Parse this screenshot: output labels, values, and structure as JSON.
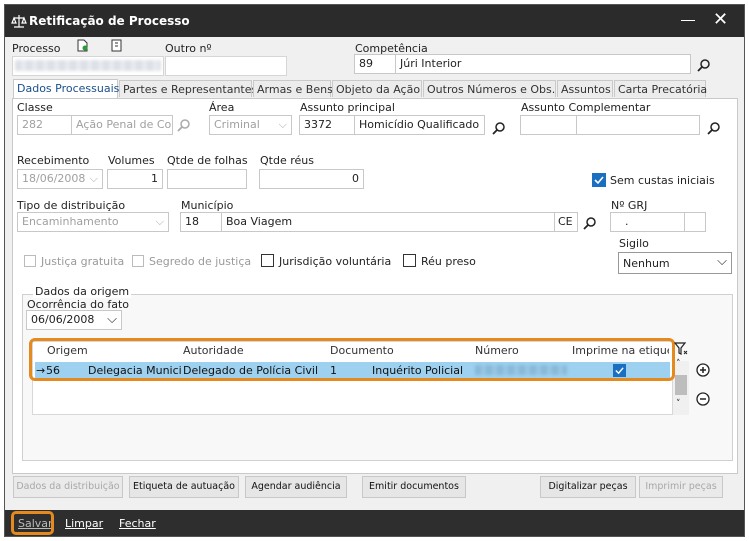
{
  "window": {
    "title": "Retificação de Processo"
  },
  "header": {
    "processo_label": "Processo",
    "outro_label": "Outro nº",
    "competencia_label": "Competência",
    "competencia_code": "89",
    "competencia_name": "Júri Interior"
  },
  "tabs": [
    {
      "label": "Dados Processuais"
    },
    {
      "label": "Partes e Representantes"
    },
    {
      "label": "Armas e Bens"
    },
    {
      "label": "Objeto da Ação"
    },
    {
      "label": "Outros Números e Obs."
    },
    {
      "label": "Assuntos"
    },
    {
      "label": "Carta Precatória"
    }
  ],
  "dados": {
    "classe_label": "Classe",
    "classe_code": "282",
    "classe_name": "Ação Penal de Com",
    "area_label": "Área",
    "area_value": "Criminal",
    "assunto_label": "Assunto principal",
    "assunto_code": "3372",
    "assunto_name": "Homicídio Qualificado",
    "assunto_comp_label": "Assunto Complementar",
    "recebimento_label": "Recebimento",
    "recebimento_value": "18/06/2008",
    "volumes_label": "Volumes",
    "volumes_value": "1",
    "qtde_folhas_label": "Qtde de folhas",
    "qtde_reus_label": "Qtde réus",
    "qtde_reus_value": "0",
    "sem_custas_label": "Sem custas iniciais",
    "tipo_dist_label": "Tipo de distribuição",
    "tipo_dist_value": "Encaminhamento",
    "municipio_label": "Município",
    "municipio_code": "18",
    "municipio_name": "Boa Viagem",
    "uf": "CE",
    "grj_label": "Nº GRJ",
    "grj_value": ".",
    "sigilo_label": "Sigilo",
    "sigilo_value": "Nenhum",
    "justica_gratuita": "Justiça gratuita",
    "segredo_justica": "Segredo de justiça",
    "jurisdicao_voluntaria": "Jurisdição voluntária",
    "reu_preso": "Réu preso"
  },
  "origem": {
    "group_title": "Dados da origem",
    "ocorrencia_label": "Ocorrência do fato",
    "ocorrencia_value": "06/06/2008",
    "columns": [
      "Origem",
      "Autoridade",
      "Documento",
      "Número",
      "Imprime na etique"
    ],
    "row": {
      "marker": "→",
      "origem_code": "56",
      "origem_name": "Delegacia Municip",
      "autoridade": "Delegado de Polícia Civil",
      "doc_code": "1",
      "documento": "Inquérito Policial"
    }
  },
  "buttons": {
    "dados_distribuicao": "Dados da distribuição",
    "etiqueta": "Etiqueta de autuação",
    "agendar": "Agendar audiência",
    "emitir": "Emitir documentos",
    "digitalizar": "Digitalizar peças",
    "imprimir": "Imprimir peças"
  },
  "bottom": {
    "salvar": "Salvar",
    "limpar": "Limpar",
    "fechar": "Fechar"
  }
}
